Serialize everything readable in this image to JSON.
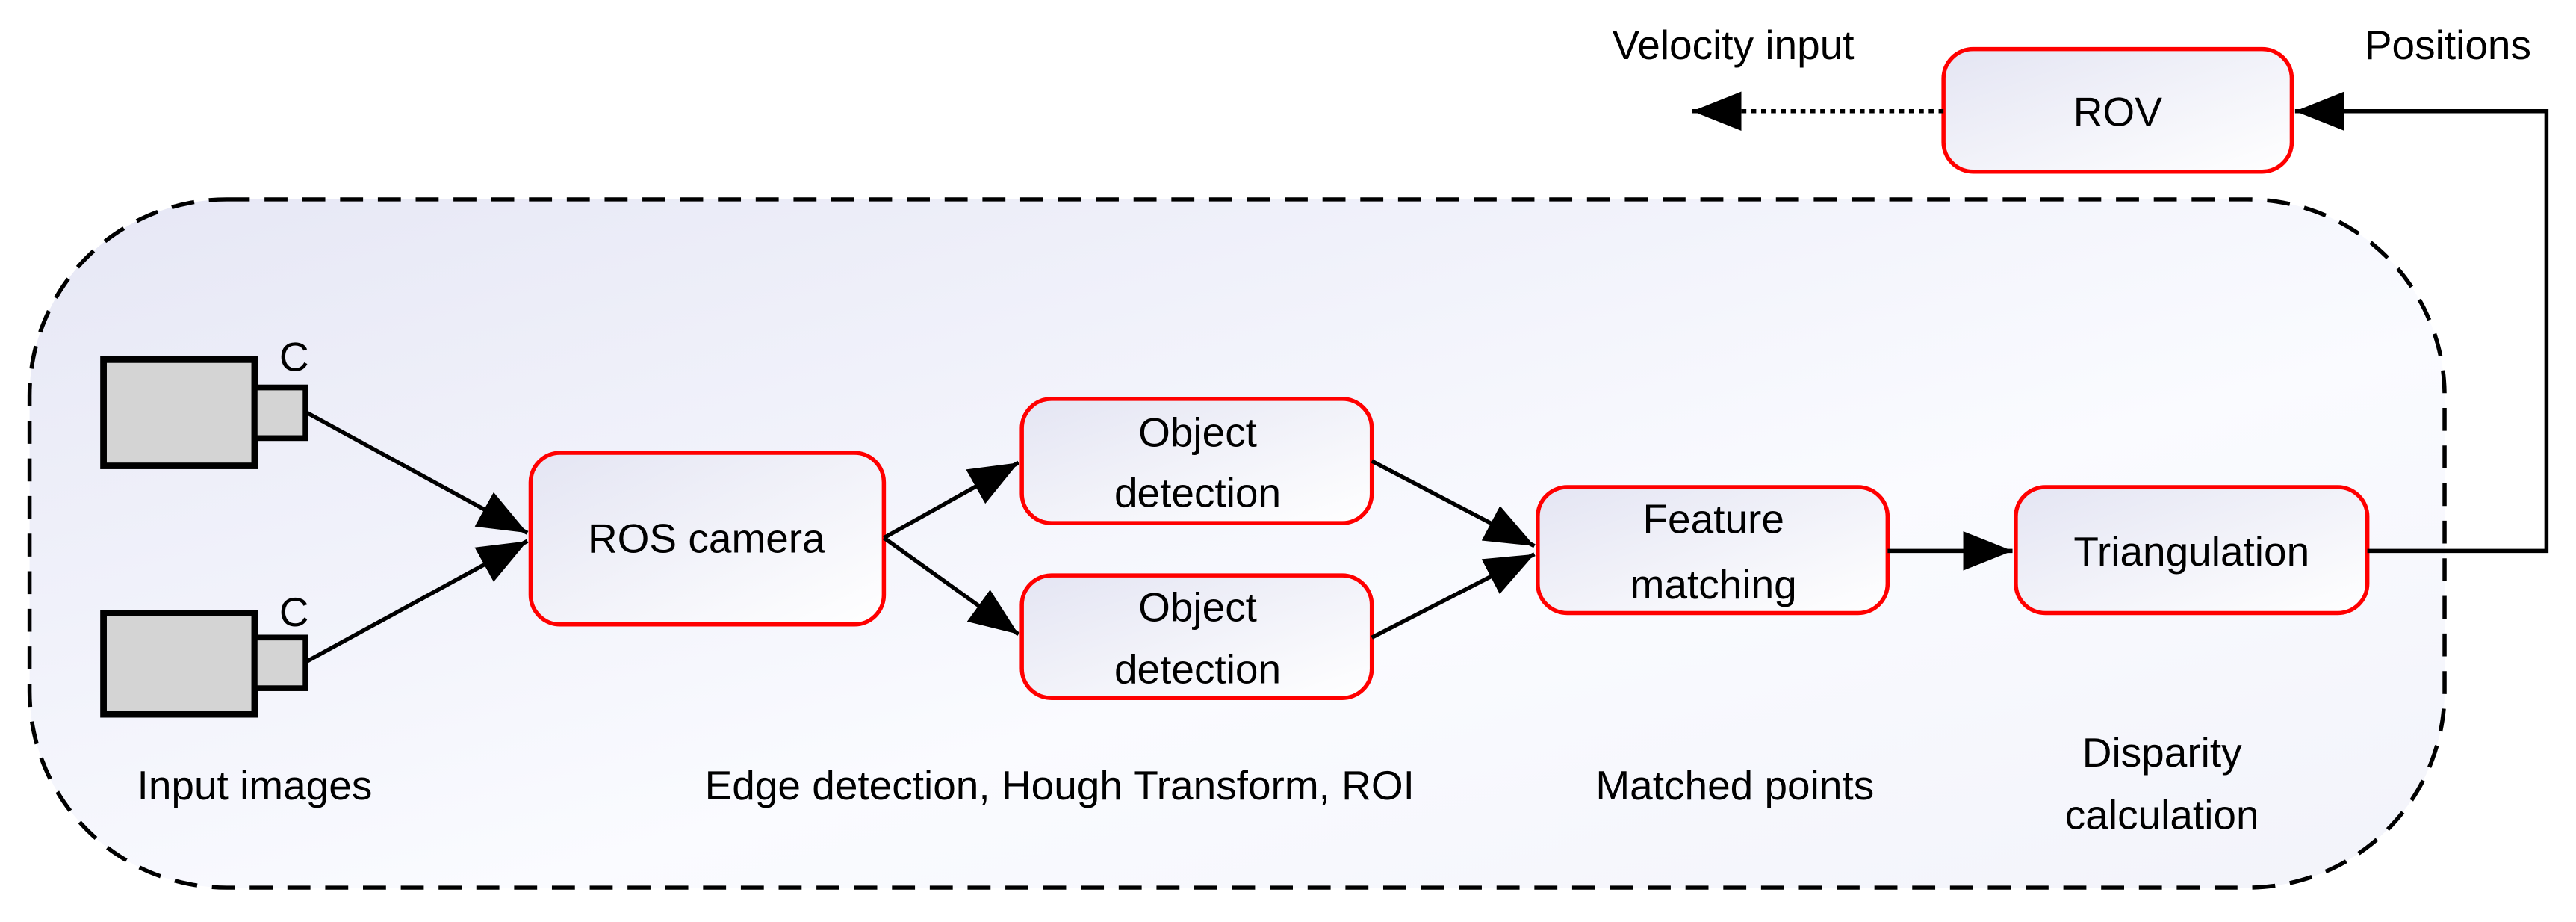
{
  "colors": {
    "box_border": "#ff0000",
    "box_fill_start": "#e8e9f5",
    "box_fill_end": "#ffffff",
    "camera_fill": "#d4d4d4",
    "line": "#000000"
  },
  "nodes": {
    "rov": "ROV",
    "ros_camera": "ROS camera",
    "object_detection_1": [
      "Object",
      "detection"
    ],
    "object_detection_2": [
      "Object",
      "detection"
    ],
    "feature_matching": [
      "Feature",
      "matching"
    ],
    "triangulation": "Triangulation"
  },
  "cameras": [
    {
      "label": "C",
      "icon": "camera-icon"
    },
    {
      "label": "C",
      "icon": "camera-icon"
    }
  ],
  "labels": {
    "velocity_input": "Velocity input",
    "positions": "Positions",
    "input_images": "Input images",
    "edge_detection": "Edge detection, Hough Transform, ROI",
    "matched_points": "Matched points",
    "disparity": [
      "Disparity",
      "calculation"
    ]
  }
}
